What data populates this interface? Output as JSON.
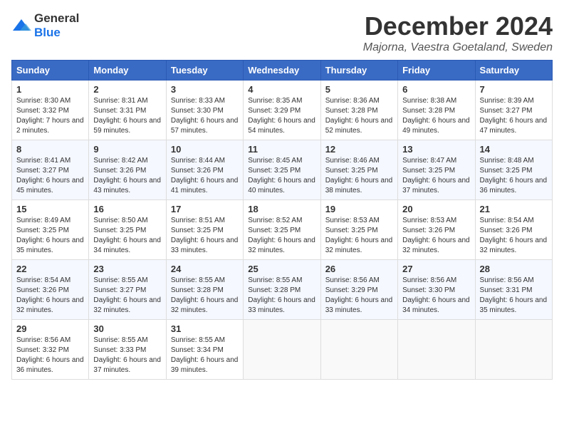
{
  "logo": {
    "general": "General",
    "blue": "Blue"
  },
  "title": "December 2024",
  "subtitle": "Majorna, Vaestra Goetaland, Sweden",
  "headers": [
    "Sunday",
    "Monday",
    "Tuesday",
    "Wednesday",
    "Thursday",
    "Friday",
    "Saturday"
  ],
  "weeks": [
    [
      {
        "day": "1",
        "sunrise": "Sunrise: 8:30 AM",
        "sunset": "Sunset: 3:32 PM",
        "daylight": "Daylight: 7 hours and 2 minutes."
      },
      {
        "day": "2",
        "sunrise": "Sunrise: 8:31 AM",
        "sunset": "Sunset: 3:31 PM",
        "daylight": "Daylight: 6 hours and 59 minutes."
      },
      {
        "day": "3",
        "sunrise": "Sunrise: 8:33 AM",
        "sunset": "Sunset: 3:30 PM",
        "daylight": "Daylight: 6 hours and 57 minutes."
      },
      {
        "day": "4",
        "sunrise": "Sunrise: 8:35 AM",
        "sunset": "Sunset: 3:29 PM",
        "daylight": "Daylight: 6 hours and 54 minutes."
      },
      {
        "day": "5",
        "sunrise": "Sunrise: 8:36 AM",
        "sunset": "Sunset: 3:28 PM",
        "daylight": "Daylight: 6 hours and 52 minutes."
      },
      {
        "day": "6",
        "sunrise": "Sunrise: 8:38 AM",
        "sunset": "Sunset: 3:28 PM",
        "daylight": "Daylight: 6 hours and 49 minutes."
      },
      {
        "day": "7",
        "sunrise": "Sunrise: 8:39 AM",
        "sunset": "Sunset: 3:27 PM",
        "daylight": "Daylight: 6 hours and 47 minutes."
      }
    ],
    [
      {
        "day": "8",
        "sunrise": "Sunrise: 8:41 AM",
        "sunset": "Sunset: 3:27 PM",
        "daylight": "Daylight: 6 hours and 45 minutes."
      },
      {
        "day": "9",
        "sunrise": "Sunrise: 8:42 AM",
        "sunset": "Sunset: 3:26 PM",
        "daylight": "Daylight: 6 hours and 43 minutes."
      },
      {
        "day": "10",
        "sunrise": "Sunrise: 8:44 AM",
        "sunset": "Sunset: 3:26 PM",
        "daylight": "Daylight: 6 hours and 41 minutes."
      },
      {
        "day": "11",
        "sunrise": "Sunrise: 8:45 AM",
        "sunset": "Sunset: 3:25 PM",
        "daylight": "Daylight: 6 hours and 40 minutes."
      },
      {
        "day": "12",
        "sunrise": "Sunrise: 8:46 AM",
        "sunset": "Sunset: 3:25 PM",
        "daylight": "Daylight: 6 hours and 38 minutes."
      },
      {
        "day": "13",
        "sunrise": "Sunrise: 8:47 AM",
        "sunset": "Sunset: 3:25 PM",
        "daylight": "Daylight: 6 hours and 37 minutes."
      },
      {
        "day": "14",
        "sunrise": "Sunrise: 8:48 AM",
        "sunset": "Sunset: 3:25 PM",
        "daylight": "Daylight: 6 hours and 36 minutes."
      }
    ],
    [
      {
        "day": "15",
        "sunrise": "Sunrise: 8:49 AM",
        "sunset": "Sunset: 3:25 PM",
        "daylight": "Daylight: 6 hours and 35 minutes."
      },
      {
        "day": "16",
        "sunrise": "Sunrise: 8:50 AM",
        "sunset": "Sunset: 3:25 PM",
        "daylight": "Daylight: 6 hours and 34 minutes."
      },
      {
        "day": "17",
        "sunrise": "Sunrise: 8:51 AM",
        "sunset": "Sunset: 3:25 PM",
        "daylight": "Daylight: 6 hours and 33 minutes."
      },
      {
        "day": "18",
        "sunrise": "Sunrise: 8:52 AM",
        "sunset": "Sunset: 3:25 PM",
        "daylight": "Daylight: 6 hours and 32 minutes."
      },
      {
        "day": "19",
        "sunrise": "Sunrise: 8:53 AM",
        "sunset": "Sunset: 3:25 PM",
        "daylight": "Daylight: 6 hours and 32 minutes."
      },
      {
        "day": "20",
        "sunrise": "Sunrise: 8:53 AM",
        "sunset": "Sunset: 3:26 PM",
        "daylight": "Daylight: 6 hours and 32 minutes."
      },
      {
        "day": "21",
        "sunrise": "Sunrise: 8:54 AM",
        "sunset": "Sunset: 3:26 PM",
        "daylight": "Daylight: 6 hours and 32 minutes."
      }
    ],
    [
      {
        "day": "22",
        "sunrise": "Sunrise: 8:54 AM",
        "sunset": "Sunset: 3:26 PM",
        "daylight": "Daylight: 6 hours and 32 minutes."
      },
      {
        "day": "23",
        "sunrise": "Sunrise: 8:55 AM",
        "sunset": "Sunset: 3:27 PM",
        "daylight": "Daylight: 6 hours and 32 minutes."
      },
      {
        "day": "24",
        "sunrise": "Sunrise: 8:55 AM",
        "sunset": "Sunset: 3:28 PM",
        "daylight": "Daylight: 6 hours and 32 minutes."
      },
      {
        "day": "25",
        "sunrise": "Sunrise: 8:55 AM",
        "sunset": "Sunset: 3:28 PM",
        "daylight": "Daylight: 6 hours and 33 minutes."
      },
      {
        "day": "26",
        "sunrise": "Sunrise: 8:56 AM",
        "sunset": "Sunset: 3:29 PM",
        "daylight": "Daylight: 6 hours and 33 minutes."
      },
      {
        "day": "27",
        "sunrise": "Sunrise: 8:56 AM",
        "sunset": "Sunset: 3:30 PM",
        "daylight": "Daylight: 6 hours and 34 minutes."
      },
      {
        "day": "28",
        "sunrise": "Sunrise: 8:56 AM",
        "sunset": "Sunset: 3:31 PM",
        "daylight": "Daylight: 6 hours and 35 minutes."
      }
    ],
    [
      {
        "day": "29",
        "sunrise": "Sunrise: 8:56 AM",
        "sunset": "Sunset: 3:32 PM",
        "daylight": "Daylight: 6 hours and 36 minutes."
      },
      {
        "day": "30",
        "sunrise": "Sunrise: 8:55 AM",
        "sunset": "Sunset: 3:33 PM",
        "daylight": "Daylight: 6 hours and 37 minutes."
      },
      {
        "day": "31",
        "sunrise": "Sunrise: 8:55 AM",
        "sunset": "Sunset: 3:34 PM",
        "daylight": "Daylight: 6 hours and 39 minutes."
      },
      null,
      null,
      null,
      null
    ]
  ]
}
